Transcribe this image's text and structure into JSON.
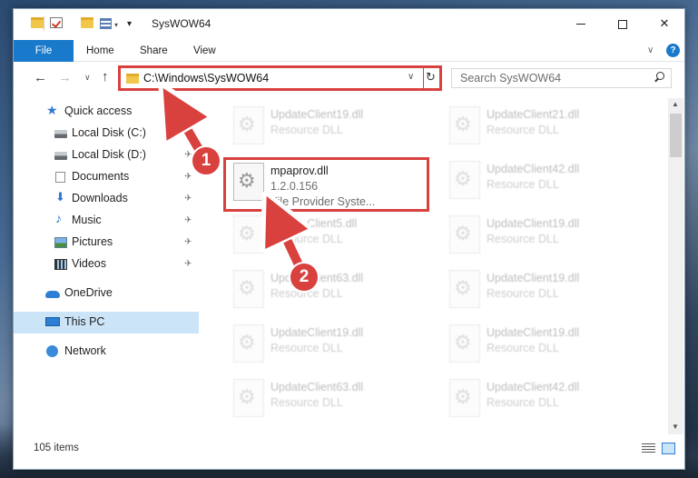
{
  "titlebar": {
    "title": "SysWOW64"
  },
  "ribbon": {
    "file": "File",
    "home": "Home",
    "share": "Share",
    "view": "View",
    "help": "?"
  },
  "address": {
    "path": "C:\\Windows\\SysWOW64"
  },
  "search": {
    "placeholder": "Search SysWOW64"
  },
  "sidebar": {
    "items": [
      {
        "label": "Quick access"
      },
      {
        "label": "Local Disk (C:)"
      },
      {
        "label": "Local Disk (D:)"
      },
      {
        "label": "Documents"
      },
      {
        "label": "Downloads"
      },
      {
        "label": "Music"
      },
      {
        "label": "Pictures"
      },
      {
        "label": "Videos"
      },
      {
        "label": "OneDrive"
      },
      {
        "label": "This PC"
      },
      {
        "label": "Network"
      }
    ]
  },
  "files": {
    "highlighted": {
      "name": "mpaprov.dll",
      "version": "1.2.0.156",
      "description": "File Provider Syste..."
    },
    "faded": [
      {
        "name": "UpdateClient19.dll",
        "type": "Resource DLL"
      },
      {
        "name": "UpdateClient21.dll",
        "type": "Resource DLL"
      },
      {
        "name": "UpdateClient42.dll",
        "type": "Resource DLL"
      },
      {
        "name": "UpdateClient5.dll",
        "type": "Resource DLL"
      },
      {
        "name": "UpdateClient19.dll",
        "type": "Resource DLL"
      },
      {
        "name": "UpdateClient63.dll",
        "type": "Resource DLL"
      },
      {
        "name": "UpdateClient19.dll",
        "type": "Resource DLL"
      },
      {
        "name": "UpdateClient19.dll",
        "type": "Resource DLL"
      },
      {
        "name": "UpdateClient19.dll",
        "type": "Resource DLL"
      },
      {
        "name": "UpdateClient63.dll",
        "type": "Resource DLL"
      },
      {
        "name": "UpdateClient42.dll",
        "type": "Resource DLL"
      }
    ]
  },
  "status": {
    "count": "105 items"
  },
  "annotations": {
    "step1": "1",
    "step2": "2"
  },
  "colors": {
    "accent": "#1979ca",
    "highlight": "#d9413f",
    "selected": "#cce4f7"
  }
}
